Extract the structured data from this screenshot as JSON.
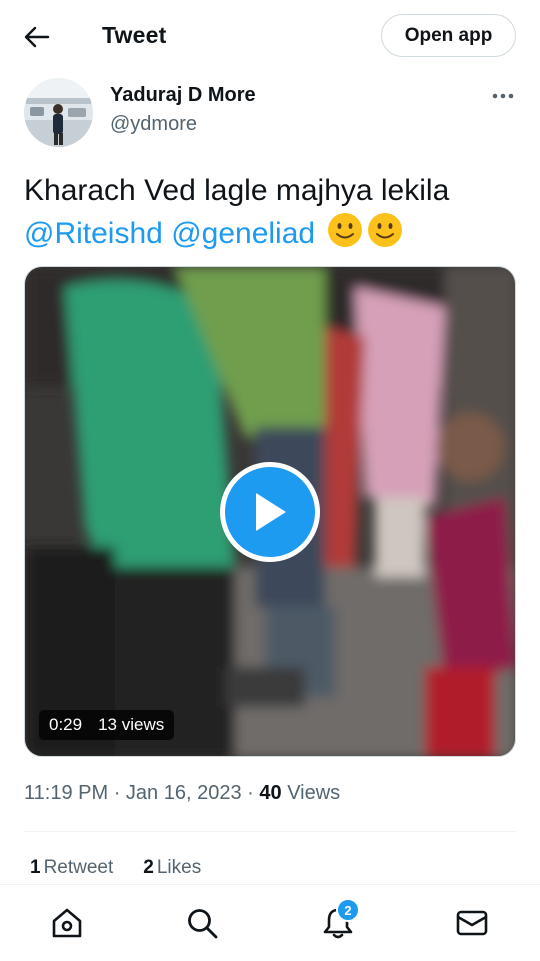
{
  "header": {
    "title": "Tweet",
    "open_app_label": "Open app"
  },
  "author": {
    "name": "Yaduraj D More",
    "handle": "@ydmore"
  },
  "tweet": {
    "text": "Kharach Ved lagle majhya lekila",
    "mentions": [
      "@Riteishd",
      "@geneliad"
    ],
    "emojis": [
      "slightly-smiling-face",
      "slightly-smiling-face"
    ]
  },
  "video": {
    "duration": "0:29",
    "views": "13 views"
  },
  "meta": {
    "time": "11:19 PM",
    "separator": "·",
    "date": "Jan 16, 2023",
    "views_count": "40",
    "views_label": "Views"
  },
  "stats": {
    "retweets_count": "1",
    "retweets_label": "Retweet",
    "likes_count": "2",
    "likes_label": "Likes"
  },
  "nav": {
    "notification_badge": "2"
  },
  "colors": {
    "accent": "#1d9bf0",
    "text": "#0f1419",
    "secondary": "#536471",
    "border": "#cfd9de"
  },
  "icons": [
    "back-arrow-icon",
    "more-icon",
    "play-icon",
    "home-icon",
    "search-icon",
    "bell-icon",
    "mail-icon"
  ]
}
